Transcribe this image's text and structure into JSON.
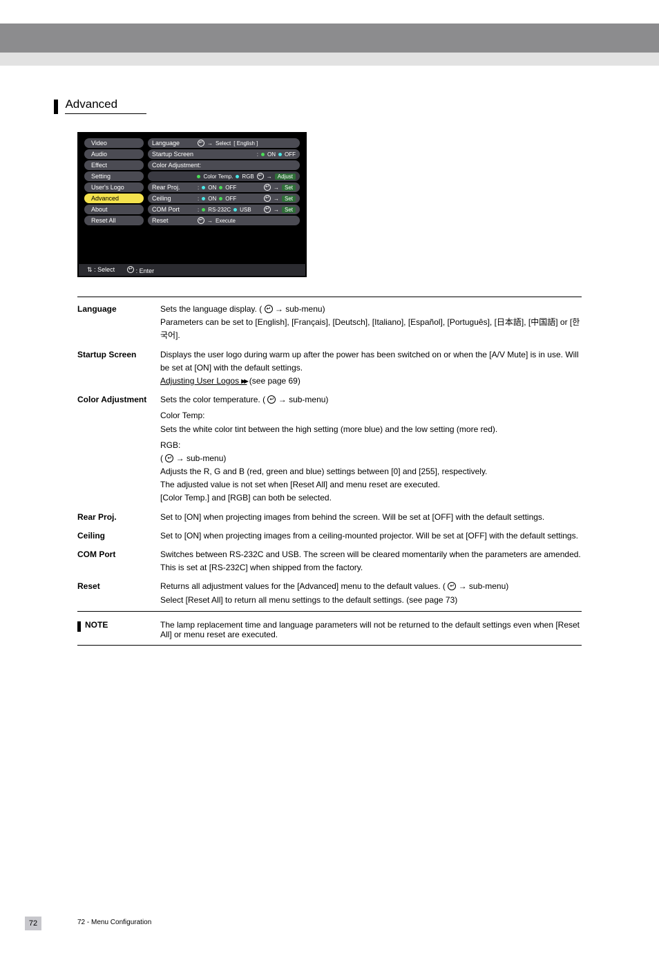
{
  "section_title": "Advanced",
  "menu": {
    "left_items": [
      {
        "label": "Video",
        "selected": false
      },
      {
        "label": "Audio",
        "selected": false
      },
      {
        "label": "Effect",
        "selected": false
      },
      {
        "label": "Setting",
        "selected": false
      },
      {
        "label": "User's Logo",
        "selected": false
      },
      {
        "label": "Advanced",
        "selected": true
      },
      {
        "label": "About",
        "selected": false
      },
      {
        "label": "Reset All",
        "selected": false
      }
    ],
    "rows": {
      "language": {
        "label": "Language",
        "action": "Select",
        "value": "English"
      },
      "startup_screen": {
        "label": "Startup Screen",
        "opt_on": "ON",
        "opt_off": "OFF"
      },
      "color_adj_header": {
        "label": "Color Adjustment:"
      },
      "color_adj_sub": {
        "opt1": "Color Temp.",
        "opt2": "RGB",
        "action": "Adjust"
      },
      "rear_proj": {
        "label": "Rear Proj.",
        "opt_on": "ON",
        "opt_off": "OFF",
        "action": "Set"
      },
      "ceiling": {
        "label": "Ceiling",
        "opt_on": "ON",
        "opt_off": "OFF",
        "action": "Set"
      },
      "com_port": {
        "label": "COM Port",
        "opt1": "RS-232C",
        "opt2": "USB",
        "action": "Set"
      },
      "reset": {
        "label": "Reset",
        "action": "Execute"
      }
    },
    "footer": {
      "select": ": Select",
      "enter": ": Enter"
    }
  },
  "rows": [
    {
      "title": "Language",
      "body": "Sets the language display. (   → sub-menu)\nParameters can be set to [English], [Français], [Deutsch], [Italiano], [Español], [Português], [日本語], [中国語] or [한국어]."
    },
    {
      "title": "Startup Screen",
      "body": "Displays the user logo during warm up after the power has been switched on or when the [A/V Mute] is in use. Will be set at [ON] with the default settings.\n Adjusting User Logos (see page 69)"
    },
    {
      "title": "Color Adjustment",
      "body_intro": "Sets the color temperature. (   → sub-menu)",
      "items": [
        {
          "k": "Color Temp:",
          "v": "Sets the white color tint between the high setting (more blue) and the low setting (more red)."
        },
        {
          "k": "RGB:",
          "v": "(   → sub-menu)\nAdjusts the R, G and B (red, green and blue) settings between [0] and [255], respectively.\nThe adjusted value is not set when [Reset All] and menu reset are executed.\n[Color Temp.] and [RGB] can both be selected."
        }
      ]
    },
    {
      "title": "Rear Proj.",
      "body": "Set to [ON] when projecting images from behind the screen. Will be set at [OFF] with the default settings."
    },
    {
      "title": "Ceiling",
      "body": "Set to [ON] when projecting images from a ceiling-mounted projector. Will be set at [OFF] with the default settings."
    },
    {
      "title": "COM Port",
      "body": "Switches between RS-232C and USB. The screen will be cleared momentarily when the parameters are amended.\nThis is set at [RS-232C] when shipped from the factory."
    },
    {
      "title": "Reset",
      "body": "Returns all adjustment values for the [Advanced] menu to the default values. (   → sub-menu)\nSelect [Reset All] to return all menu settings to the default settings. (see page 73)"
    }
  ],
  "note": {
    "label": "NOTE",
    "text": "The lamp replacement time and language parameters will not be returned to the default settings even when [Reset All] or menu reset are executed."
  },
  "page_number": "72",
  "footer_text": "72 - Menu Configuration"
}
